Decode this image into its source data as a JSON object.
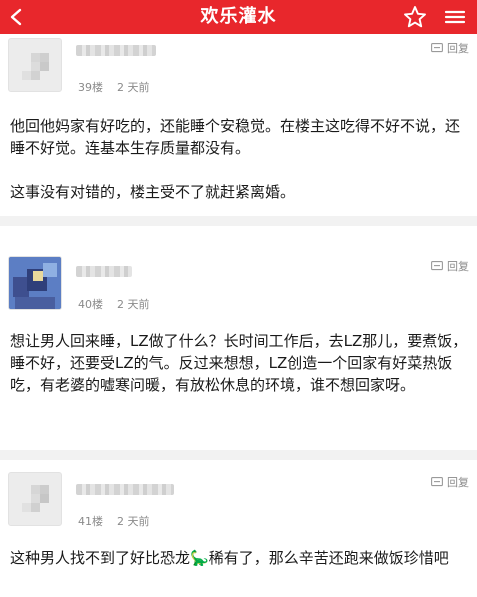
{
  "header": {
    "title": "欢乐灌水",
    "back_icon": "back-arrow-icon",
    "star_icon": "star-outline-icon",
    "more_icon": "more-menu-icon",
    "bg_color": "#e8272c"
  },
  "reply_label": "回复",
  "posts": [
    {
      "floor": "39楼",
      "time": "2 天前",
      "content": "他回他妈家有好吃的，还能睡个安稳觉。在楼主这吃得不好不说，还睡不好觉。连基本生存质量都没有。\n\n这事没有对错的，楼主受不了就赶紧离婚。"
    },
    {
      "floor": "40楼",
      "time": "2 天前",
      "content": "想让男人回来睡，LZ做了什么？长时间工作后，去LZ那儿，要煮饭，睡不好，还要受LZ的气。反过来想想，LZ创造一个回家有好菜热饭吃，有老婆的嘘寒问暖，有放松休息的环境，谁不想回家呀。"
    },
    {
      "floor": "41楼",
      "time": "2 天前",
      "content_before": "这种男人找不到了好比恐龙",
      "emoji": "🦕",
      "content_after": "稀有了，那么辛苦还跑来做饭珍惜吧"
    }
  ]
}
